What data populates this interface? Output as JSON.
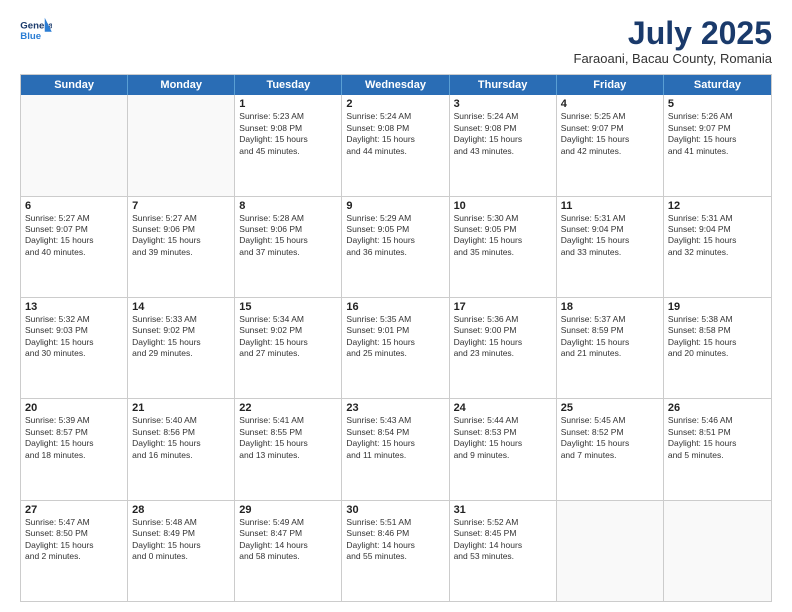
{
  "logo": {
    "line1": "General",
    "line2": "Blue"
  },
  "title": "July 2025",
  "subtitle": "Faraoani, Bacau County, Romania",
  "header_days": [
    "Sunday",
    "Monday",
    "Tuesday",
    "Wednesday",
    "Thursday",
    "Friday",
    "Saturday"
  ],
  "weeks": [
    [
      {
        "day": "",
        "info": ""
      },
      {
        "day": "",
        "info": ""
      },
      {
        "day": "1",
        "info": "Sunrise: 5:23 AM\nSunset: 9:08 PM\nDaylight: 15 hours\nand 45 minutes."
      },
      {
        "day": "2",
        "info": "Sunrise: 5:24 AM\nSunset: 9:08 PM\nDaylight: 15 hours\nand 44 minutes."
      },
      {
        "day": "3",
        "info": "Sunrise: 5:24 AM\nSunset: 9:08 PM\nDaylight: 15 hours\nand 43 minutes."
      },
      {
        "day": "4",
        "info": "Sunrise: 5:25 AM\nSunset: 9:07 PM\nDaylight: 15 hours\nand 42 minutes."
      },
      {
        "day": "5",
        "info": "Sunrise: 5:26 AM\nSunset: 9:07 PM\nDaylight: 15 hours\nand 41 minutes."
      }
    ],
    [
      {
        "day": "6",
        "info": "Sunrise: 5:27 AM\nSunset: 9:07 PM\nDaylight: 15 hours\nand 40 minutes."
      },
      {
        "day": "7",
        "info": "Sunrise: 5:27 AM\nSunset: 9:06 PM\nDaylight: 15 hours\nand 39 minutes."
      },
      {
        "day": "8",
        "info": "Sunrise: 5:28 AM\nSunset: 9:06 PM\nDaylight: 15 hours\nand 37 minutes."
      },
      {
        "day": "9",
        "info": "Sunrise: 5:29 AM\nSunset: 9:05 PM\nDaylight: 15 hours\nand 36 minutes."
      },
      {
        "day": "10",
        "info": "Sunrise: 5:30 AM\nSunset: 9:05 PM\nDaylight: 15 hours\nand 35 minutes."
      },
      {
        "day": "11",
        "info": "Sunrise: 5:31 AM\nSunset: 9:04 PM\nDaylight: 15 hours\nand 33 minutes."
      },
      {
        "day": "12",
        "info": "Sunrise: 5:31 AM\nSunset: 9:04 PM\nDaylight: 15 hours\nand 32 minutes."
      }
    ],
    [
      {
        "day": "13",
        "info": "Sunrise: 5:32 AM\nSunset: 9:03 PM\nDaylight: 15 hours\nand 30 minutes."
      },
      {
        "day": "14",
        "info": "Sunrise: 5:33 AM\nSunset: 9:02 PM\nDaylight: 15 hours\nand 29 minutes."
      },
      {
        "day": "15",
        "info": "Sunrise: 5:34 AM\nSunset: 9:02 PM\nDaylight: 15 hours\nand 27 minutes."
      },
      {
        "day": "16",
        "info": "Sunrise: 5:35 AM\nSunset: 9:01 PM\nDaylight: 15 hours\nand 25 minutes."
      },
      {
        "day": "17",
        "info": "Sunrise: 5:36 AM\nSunset: 9:00 PM\nDaylight: 15 hours\nand 23 minutes."
      },
      {
        "day": "18",
        "info": "Sunrise: 5:37 AM\nSunset: 8:59 PM\nDaylight: 15 hours\nand 21 minutes."
      },
      {
        "day": "19",
        "info": "Sunrise: 5:38 AM\nSunset: 8:58 PM\nDaylight: 15 hours\nand 20 minutes."
      }
    ],
    [
      {
        "day": "20",
        "info": "Sunrise: 5:39 AM\nSunset: 8:57 PM\nDaylight: 15 hours\nand 18 minutes."
      },
      {
        "day": "21",
        "info": "Sunrise: 5:40 AM\nSunset: 8:56 PM\nDaylight: 15 hours\nand 16 minutes."
      },
      {
        "day": "22",
        "info": "Sunrise: 5:41 AM\nSunset: 8:55 PM\nDaylight: 15 hours\nand 13 minutes."
      },
      {
        "day": "23",
        "info": "Sunrise: 5:43 AM\nSunset: 8:54 PM\nDaylight: 15 hours\nand 11 minutes."
      },
      {
        "day": "24",
        "info": "Sunrise: 5:44 AM\nSunset: 8:53 PM\nDaylight: 15 hours\nand 9 minutes."
      },
      {
        "day": "25",
        "info": "Sunrise: 5:45 AM\nSunset: 8:52 PM\nDaylight: 15 hours\nand 7 minutes."
      },
      {
        "day": "26",
        "info": "Sunrise: 5:46 AM\nSunset: 8:51 PM\nDaylight: 15 hours\nand 5 minutes."
      }
    ],
    [
      {
        "day": "27",
        "info": "Sunrise: 5:47 AM\nSunset: 8:50 PM\nDaylight: 15 hours\nand 2 minutes."
      },
      {
        "day": "28",
        "info": "Sunrise: 5:48 AM\nSunset: 8:49 PM\nDaylight: 15 hours\nand 0 minutes."
      },
      {
        "day": "29",
        "info": "Sunrise: 5:49 AM\nSunset: 8:47 PM\nDaylight: 14 hours\nand 58 minutes."
      },
      {
        "day": "30",
        "info": "Sunrise: 5:51 AM\nSunset: 8:46 PM\nDaylight: 14 hours\nand 55 minutes."
      },
      {
        "day": "31",
        "info": "Sunrise: 5:52 AM\nSunset: 8:45 PM\nDaylight: 14 hours\nand 53 minutes."
      },
      {
        "day": "",
        "info": ""
      },
      {
        "day": "",
        "info": ""
      }
    ]
  ]
}
